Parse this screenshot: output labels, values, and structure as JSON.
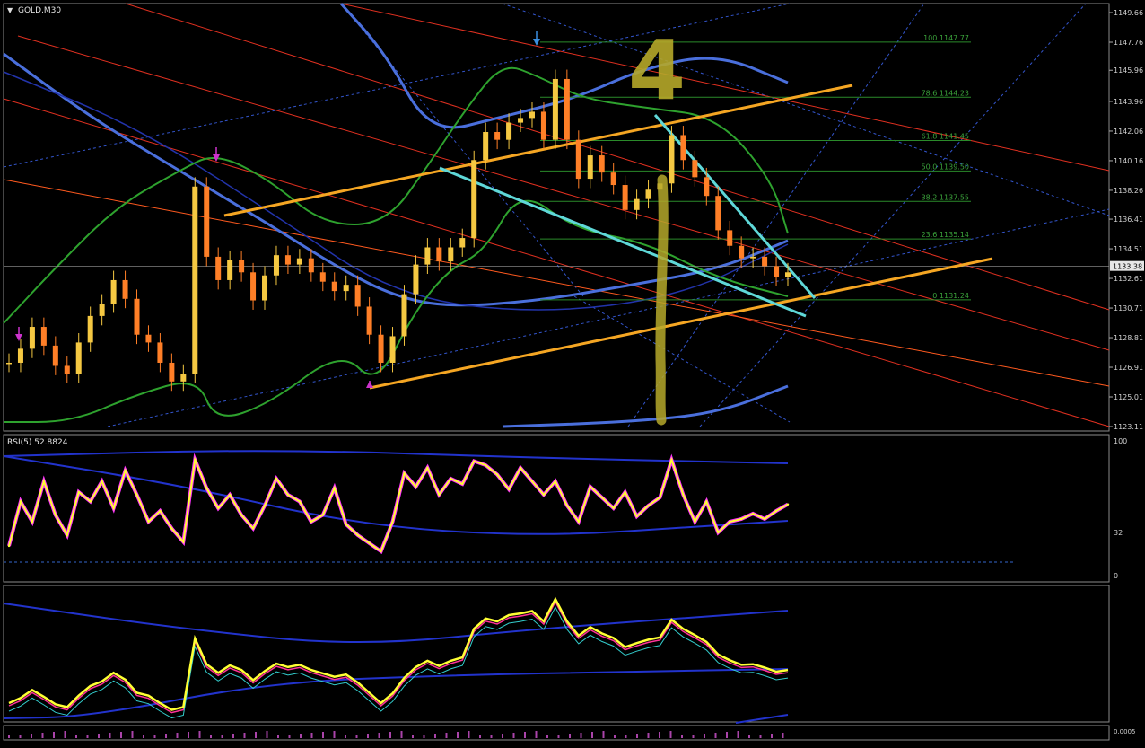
{
  "window": {
    "symbol_title": "GOLD,M30"
  },
  "main_pane": {
    "price_scale": [
      "1149.66",
      "1147.76",
      "1145.96",
      "1143.96",
      "1142.06",
      "1140.16",
      "1138.26",
      "1136.41",
      "1134.51",
      "1132.61",
      "1130.71",
      "1128.81",
      "1126.91",
      "1125.01",
      "1123.11"
    ],
    "current_price": "1133.38",
    "fib_levels": [
      "100 1147.77",
      "78.6 1144.23",
      "61.8 1141.45",
      "50.0 1139.50",
      "38.2 1137.55",
      "23.6 1135.14",
      "0 1131.24"
    ],
    "annotation_wave": "4"
  },
  "rsi_pane": {
    "title": "RSI(5) 52.8824",
    "scale": [
      "100",
      "32",
      "0"
    ]
  },
  "osc_pane": {
    "title": "",
    "scale": [
      "0.0005"
    ]
  },
  "colors": {
    "bull_candle": "#f5c842",
    "bear_candle": "#ff7f27",
    "bands_green": "#2ea22e",
    "ma_blue": "#4a6fdc",
    "channel_orange": "#f5a623",
    "trend_cyan": "#5fd8d8",
    "red_line": "#e03020",
    "rsi_yellow": "#ffff33",
    "rsi_magenta": "#ff33ff",
    "annotation_olive": "#b5a82a"
  },
  "chart_data": [
    {
      "type": "line",
      "title": "GOLD,M30",
      "ylim": [
        1123.11,
        1149.66
      ],
      "series": [
        {
          "values": [
            1127.2,
            1128.1,
            1129.5,
            1128.3,
            1127.0,
            1126.5,
            1128.5,
            1130.2,
            1131.0,
            1132.5,
            1131.3,
            1129.0,
            1128.5,
            1127.2,
            1126.0,
            1126.5,
            1138.5,
            1134.0,
            1132.5,
            1133.8,
            1133.0,
            1131.2,
            1132.8,
            1134.1,
            1133.5,
            1133.9,
            1133.0,
            1132.4,
            1131.8,
            1132.2,
            1130.8,
            1129.0,
            1127.2,
            1128.9,
            1131.6,
            1133.5,
            1134.6,
            1133.7,
            1134.6,
            1135.2,
            1140.2,
            1142.0,
            1141.5,
            1142.6,
            1142.9,
            1143.3,
            1141.5,
            1145.4,
            1141.5,
            1139.0,
            1140.5,
            1139.4,
            1138.6,
            1137.0,
            1137.7,
            1138.3,
            1138.7,
            1141.8,
            1140.2,
            1139.1,
            1137.9,
            1135.7,
            1134.7,
            1133.9,
            1134.0,
            1133.4,
            1132.7,
            1133.0
          ]
        }
      ]
    },
    {
      "type": "line",
      "title": "RSI(5) 52.8824",
      "ylim": [
        0,
        100
      ],
      "series": [
        {
          "values": [
            22,
            55,
            40,
            70,
            45,
            30,
            62,
            55,
            70,
            50,
            78,
            60,
            40,
            48,
            35,
            25,
            86,
            65,
            50,
            60,
            45,
            35,
            52,
            72,
            60,
            55,
            40,
            45,
            65,
            38,
            30,
            24,
            18,
            40,
            76,
            66,
            80,
            60,
            72,
            68,
            85,
            82,
            75,
            64,
            80,
            70,
            60,
            70,
            52,
            40,
            66,
            58,
            50,
            62,
            44,
            52,
            58,
            86,
            60,
            40,
            55,
            32,
            40,
            42,
            46,
            42,
            48,
            52.9
          ]
        }
      ]
    }
  ]
}
